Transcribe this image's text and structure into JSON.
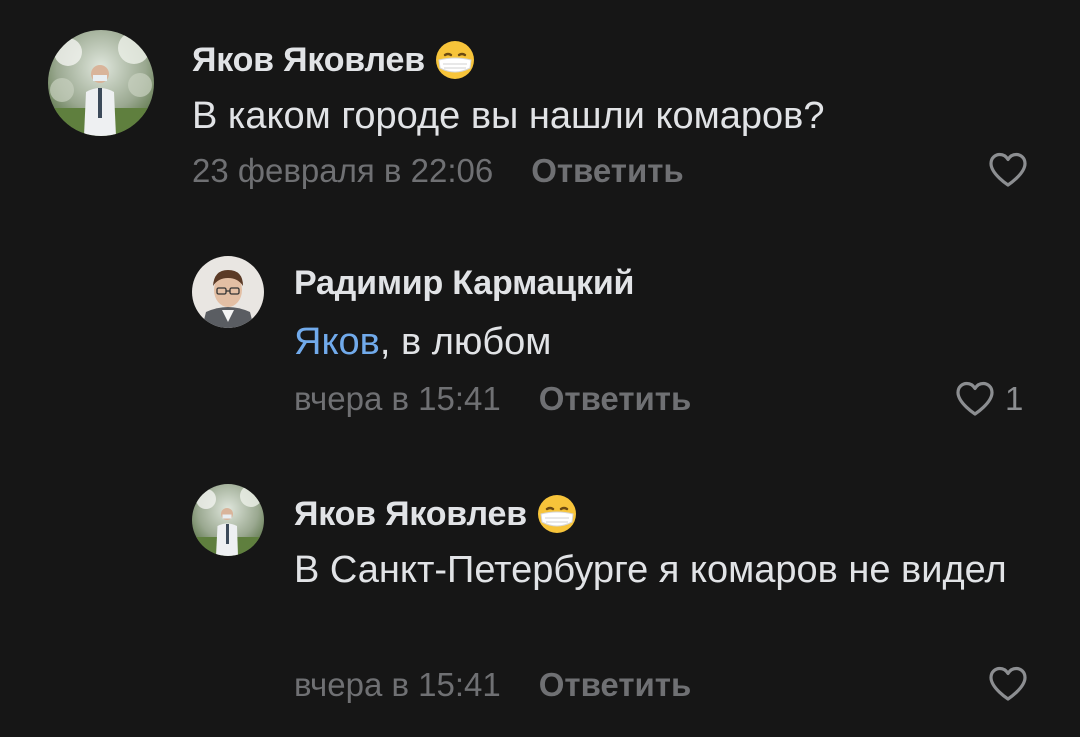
{
  "colors": {
    "background": "#161616",
    "text_primary": "#e1e3e6",
    "text_secondary": "#6f7073",
    "mention": "#71aaeb",
    "icon": "#8c8e91"
  },
  "comments": [
    {
      "author": "Яков Яковлев",
      "author_emoji": "face-with-medical-mask-icon",
      "text": "В каком городе вы нашли комаров?",
      "timestamp": "23 февраля в 22:06",
      "reply_label": "Ответить",
      "likes": ""
    },
    {
      "author": "Радимир Кармацкий",
      "mention": "Яков",
      "text": ", в любом",
      "timestamp": "вчера в 15:41",
      "reply_label": "Ответить",
      "likes": "1"
    },
    {
      "author": "Яков Яковлев",
      "author_emoji": "face-with-medical-mask-icon",
      "text": "В Санкт-Петербурге я комаров не видел",
      "timestamp": "вчера в 15:41",
      "reply_label": "Ответить",
      "likes": ""
    }
  ]
}
